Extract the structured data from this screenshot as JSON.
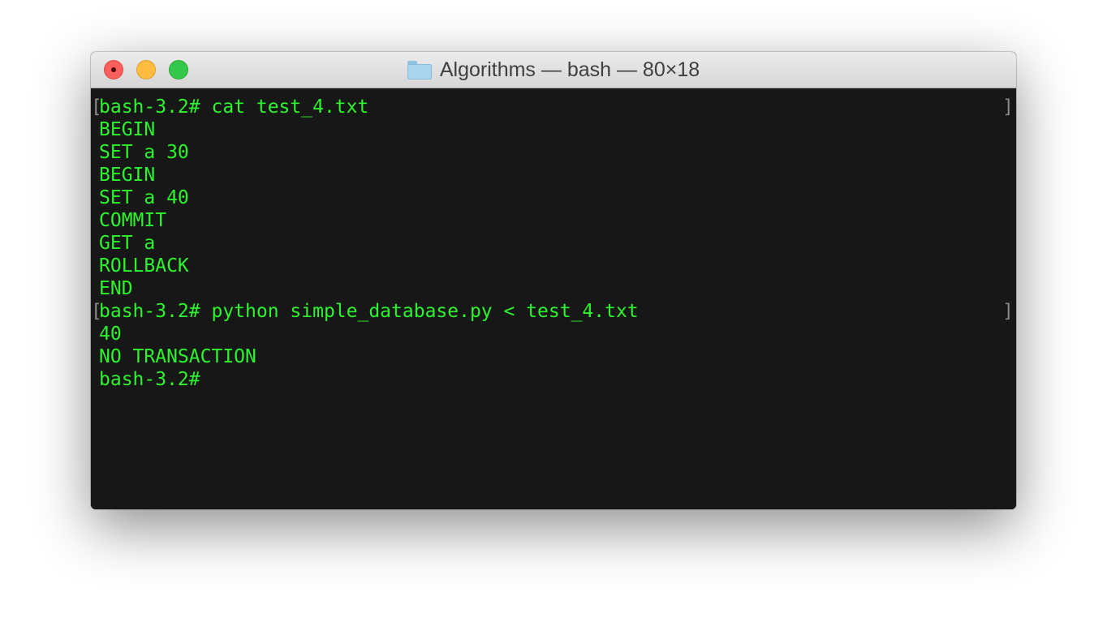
{
  "window": {
    "title": "Algorithms — bash — 80×18",
    "controls": {
      "close": "close",
      "minimize": "minimize",
      "zoom": "zoom"
    }
  },
  "terminal": {
    "lines": [
      "bash-3.2# cat test_4.txt",
      "BEGIN",
      "SET a 30",
      "BEGIN",
      "SET a 40",
      "COMMIT",
      "GET a",
      "ROLLBACK",
      "END",
      "bash-3.2# python simple_database.py < test_4.txt",
      "40",
      "NO TRANSACTION",
      "bash-3.2#"
    ],
    "mark_left": "[",
    "mark_right": "]"
  },
  "colors": {
    "text": "#2df52d",
    "background": "#171717",
    "mark": "#8a8a8a"
  }
}
